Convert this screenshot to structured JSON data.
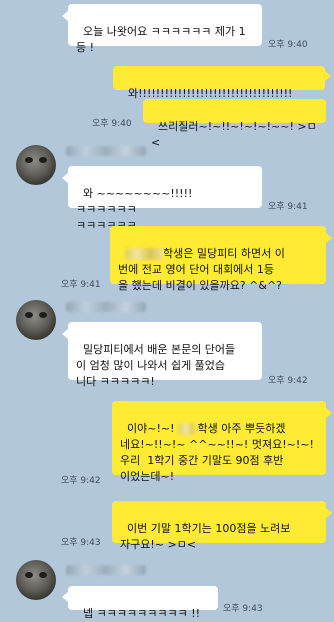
{
  "messages": [
    {
      "text": "오늘 나왓어요 ㅋㅋㅋㅋㅋㅋ 제가 1\n등 !",
      "time": "오후 9:40"
    },
    {
      "text": "와!!!!!!!!!!!!!!!!!!!!!!!!!!!!!!!!!!!"
    },
    {
      "text": "쓰리질러~!~!!~!~!~!~~! >ㅁ<",
      "time": "오후 9:40"
    },
    {
      "text": "와 ~~~~~~~~!!!!! ㅋㅋㅋㅋㅋㅋ\nㅋㅋㅋㅋㅋㅋ",
      "time": "오후 9:41"
    },
    {
      "text_after_name": "학생은 밀당피티 하면서 이\n번에 전교 영어 단어 대회에서 1등\n을 했는데 비결이 있을까요? ^&^?",
      "time": "오후 9:41"
    },
    {
      "text": "밀당피티에서 배운 본문의 단어들\n이 엄청 많이 나와서 쉽게 풀었습\n니다 ㅋㅋㅋㅋㅋ!",
      "time": "오후 9:42"
    },
    {
      "prefix": "이야~!~! ",
      "suffix": " 학생 아주 뿌듯하겠\n네요!~!!~!~ ^^~~!!~! 멋져요!~!~!\n우리  1학기 중간 기말도 90점 후반\n이었는데~!",
      "time": "오후 9:42"
    },
    {
      "text": "이번 기말 1학기는 100점을 노려보\n자구요!~ >ㅁ<",
      "time": "오후 9:43"
    },
    {
      "text": "넵 ㅋㅋㅋㅋㅋㅋㅋㅋㅋ !!",
      "time": "오후 9:43"
    }
  ]
}
